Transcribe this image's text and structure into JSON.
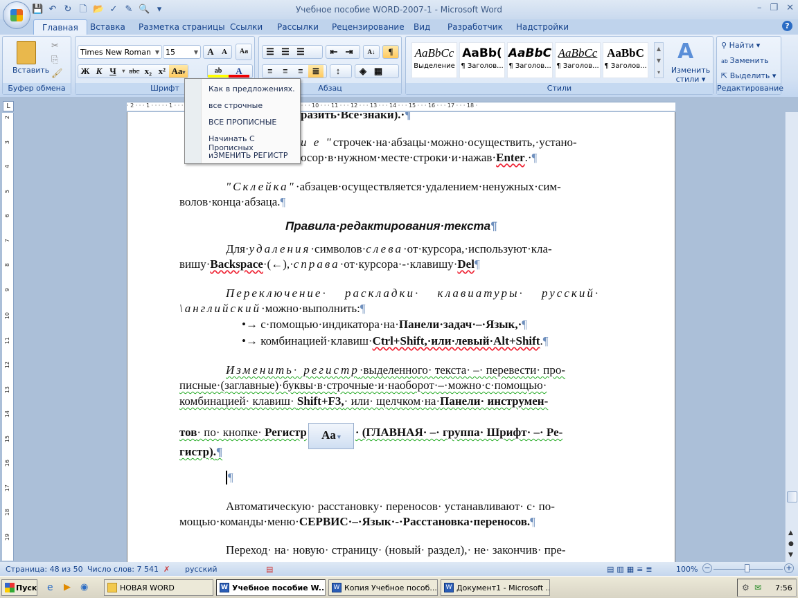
{
  "window": {
    "title": "Учебное пособие WORD-2007-1 - Microsoft Word",
    "controls": [
      "–",
      "❐",
      "✕"
    ]
  },
  "qat": {
    "icons": [
      "save-icon",
      "undo-icon",
      "redo-icon",
      "new-icon",
      "open-icon",
      "spelling-icon",
      "edit-icon",
      "print-preview-icon"
    ],
    "glyphs": [
      "💾",
      "↶",
      "↻",
      "🗋",
      "📂",
      "✓",
      "✎",
      "🔍"
    ],
    "customize": "▾"
  },
  "tabs": [
    {
      "label": "Главная",
      "active": true
    },
    {
      "label": "Вставка"
    },
    {
      "label": "Разметка страницы"
    },
    {
      "label": "Ссылки"
    },
    {
      "label": "Рассылки"
    },
    {
      "label": "Рецензирование"
    },
    {
      "label": "Вид"
    },
    {
      "label": "Разработчик"
    },
    {
      "label": "Надстройки"
    }
  ],
  "help": "?",
  "ribbon": {
    "clipboard": {
      "label": "Буфер обмена",
      "paste": "Вставить"
    },
    "font": {
      "label": "Шрифт",
      "name": "Times New Roman",
      "size": "15",
      "grow": "A",
      "shrink": "A",
      "bold": "Ж",
      "italic": "К",
      "underline": "Ч",
      "strike": "abc",
      "sub": "x₂",
      "sup": "x²",
      "case": "Aa",
      "color": "A",
      "highlight": "ab"
    },
    "paragraph": {
      "label": "Абзац",
      "sort": "А↓",
      "pilcrow": "¶"
    },
    "styles": {
      "label": "Стили",
      "items": [
        {
          "sample": "AaBbCc",
          "name": "Выделение"
        },
        {
          "sample": "AaBb(",
          "name": "¶ Заголов..."
        },
        {
          "sample": "AaBbC",
          "name": "¶ Заголов..."
        },
        {
          "sample": "AaBbCc",
          "name": "¶ Заголов..."
        },
        {
          "sample": "AaBbC",
          "name": "¶ Заголов..."
        }
      ],
      "change": "Изменить стили ▾"
    },
    "editing": {
      "label": "Редактирование",
      "find": "Найти ▾",
      "replace": "Заменить",
      "select": "Выделить ▾"
    }
  },
  "case_menu": {
    "items": [
      "Как в предложениях.",
      "все строчные",
      "ВСЕ ПРОПИСНЫЕ",
      "Начинать С Прописных",
      "иЗМЕНИТЬ РЕГИСТР"
    ]
  },
  "ruler": {
    "h": "· 2 · · · 1 · · · · · 1 · · · 2 · · · 3 · · · 4 · · · 5 · · · 6 · · · 7 · · · 8 · · · 9 · · · 10 · · · 11 · · · 12 · · · 13 · · · 14 · · · 15 · · · 16 · · · 17 · · · 18 ·",
    "v": [
      "2",
      "3",
      "4",
      "5",
      "6",
      "7",
      "8",
      "9",
      "10",
      "11",
      "12",
      "13",
      "14",
      "15",
      "16",
      "17",
      "18",
      "19"
    ]
  },
  "doc": {
    "l1": "разить·Все·знаки).·",
    "l2a": "и е \"",
    "l2b": "строчек·на·абзацы·можно·осуществить,·устано-",
    "l3a": "осор·в·нужном·месте·строки·и·нажав·",
    "l3b": "Enter",
    "l3c": ".·",
    "p2a": "\"Склейка\"",
    "p2b": "·абзацев·осуществляется·удалением·ненужных·сим-",
    "p2c": "волов·конца·абзаца.",
    "heading": "Правила·редактирования·текста",
    "p3a": "Для·",
    "p3b": "удаления",
    "p3c": "·символов·",
    "p3d": "слева",
    "p3e": "·от·курсора,·используют·кла-",
    "p3f": "вишу·",
    "p3g": "Backspace",
    "p3h": "·(←),·",
    "p3i": "справа",
    "p3j": "·от·курсора·-·клавишу·",
    "p3k": "Del",
    "p4a": "Переключение· раскладки· клавиатуры· русский·",
    "p4b": "\\английский",
    "p4c": "·можно·выполнить:",
    "b1a": "•→ с·помощью·индикатора·на·",
    "b1b": "Панели·задач·–·Язык,·",
    "b2a": "•→ комбинацией·клавиш·",
    "b2b": "Ctrl+Shift,·или·левый·Alt+Shift",
    "p5a": "Изменить· регистр",
    "p5b": "·выделенного· текста· –· перевести· про-",
    "p5c": "писные·(заглавные)·буквы·в·строчные·и·наоборот·–·можно·с·помощью·",
    "p5d": "комбинацией· клавиш· ",
    "p5e": "Shift+F3,",
    "p5f": "· или· щелчком·на·",
    "p5g": "Панели· инструмен-",
    "p5h": "тов",
    "p5i": "· по· кнопке· ",
    "p5j": "Регистр",
    "p5k": "· (ГЛАВНАЯ· –· группа· Шрифт· –· Ре-",
    "p5l": "гистр).",
    "btn": "Aa",
    "p6a": "Автоматическую· расстановку· переносов· устанавливают· с· по-",
    "p6b": "мощью·команды·меню·",
    "p6c": "СЕРВИС·–·Язык·-·Расстановка·переносов.",
    "p7": "Переход· на· новую· страницу· (новый· раздел),· не· закончив· пре-",
    "pilcrow": "¶"
  },
  "status": {
    "page": "Страница: 48 из 50",
    "words": "Число слов: 7 541",
    "lang": "русский",
    "zoom": "100%"
  },
  "taskbar": {
    "start": "Пуск",
    "items": [
      {
        "label": "НОВАЯ WORD"
      },
      {
        "label": "Учебное пособие W...",
        "active": true
      },
      {
        "label": "Копия Учебное пособ..."
      },
      {
        "label": "Документ1 - Microsoft ..."
      }
    ],
    "clock": "7:56"
  }
}
